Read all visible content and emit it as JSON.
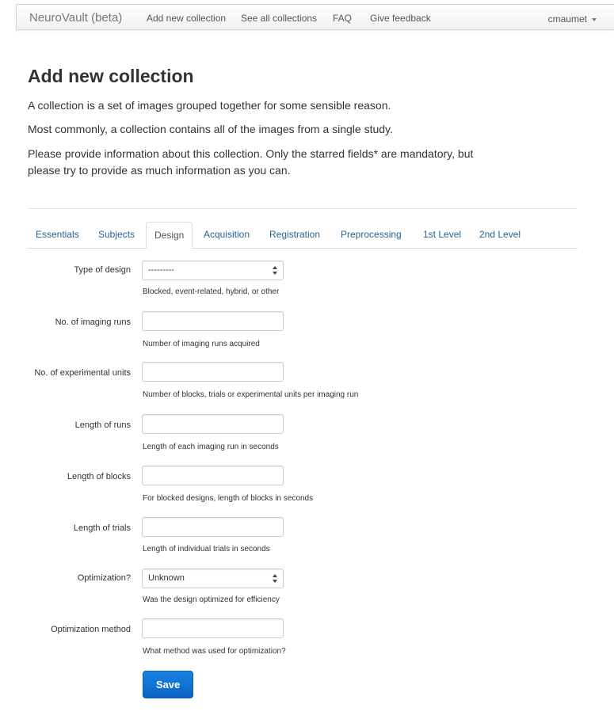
{
  "navbar": {
    "brand": "NeuroVault (beta)",
    "links": [
      "Add new collection",
      "See all collections",
      "FAQ",
      "Give feedback"
    ],
    "user": "cmaumet"
  },
  "page": {
    "title": "Add new collection",
    "intro": [
      "A collection is a set of images grouped together for some sensible reason.",
      "Most commonly, a collection contains all of the images from a single study.",
      "Please provide information about this collection. Only the starred fields* are mandatory, but please try to provide as much information as you can."
    ]
  },
  "tabs": [
    "Essentials",
    "Subjects",
    "Design",
    "Acquisition",
    "Registration",
    "Preprocessing",
    "1st Level",
    "2nd Level"
  ],
  "active_tab": "Design",
  "form": {
    "fields": [
      {
        "label": "Type of design",
        "type": "select",
        "value": "---------",
        "help": "Blocked, event-related, hybrid, or other"
      },
      {
        "label": "No. of imaging runs",
        "type": "text",
        "value": "",
        "help": "Number of imaging runs acquired"
      },
      {
        "label": "No. of experimental units",
        "type": "text",
        "value": "",
        "help": "Number of blocks, trials or experimental units per imaging run"
      },
      {
        "label": "Length of runs",
        "type": "text",
        "value": "",
        "help": "Length of each imaging run in seconds"
      },
      {
        "label": "Length of blocks",
        "type": "text",
        "value": "",
        "help": "For blocked designs, length of blocks in seconds"
      },
      {
        "label": "Length of trials",
        "type": "text",
        "value": "",
        "help": "Length of individual trials in seconds"
      },
      {
        "label": "Optimization?",
        "type": "select",
        "value": "Unknown",
        "help": "Was the design optimized for efficiency"
      },
      {
        "label": "Optimization method",
        "type": "text",
        "value": "",
        "help": "What method was used for optimization?"
      }
    ],
    "save_label": "Save"
  },
  "colors": {
    "link": "#2a6496",
    "primary_button": "#1672d6",
    "navbar_bg": "#f8f8f8"
  }
}
